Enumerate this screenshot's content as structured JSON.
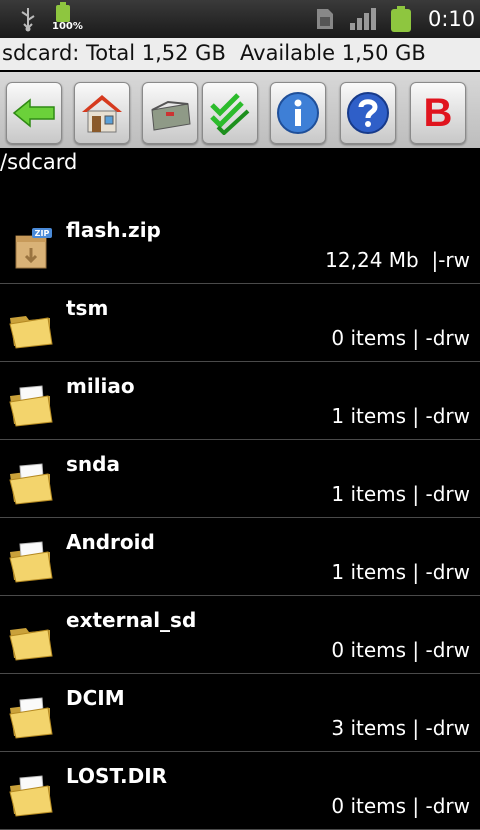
{
  "statusbar": {
    "battery_percent": "100%",
    "time": "0:10"
  },
  "storage": {
    "total": "sdcard: Total 1,52 GB",
    "available": "Available 1,50 GB"
  },
  "toolbar": [
    {
      "name": "back-button",
      "icon": "green-left-arrow-icon"
    },
    {
      "name": "home-button",
      "icon": "home-icon"
    },
    {
      "name": "multi-select-button",
      "icon": "toolbox-icon"
    },
    {
      "name": "check-all-button",
      "icon": "green-checks-icon"
    },
    {
      "name": "info-button",
      "icon": "info-icon"
    },
    {
      "name": "help-button",
      "icon": "help-icon"
    },
    {
      "name": "bookmark-button",
      "icon": "red-b-icon",
      "letter": "B"
    }
  ],
  "path": "/sdcard",
  "files": [
    {
      "name": "flash.zip",
      "meta": "12,24 Mb  |-rw",
      "type": "zip"
    },
    {
      "name": "tsm",
      "meta": "0 items | -drw",
      "type": "folder"
    },
    {
      "name": "miliao",
      "meta": "1 items | -drw",
      "type": "folder"
    },
    {
      "name": "snda",
      "meta": "1 items | -drw",
      "type": "folder"
    },
    {
      "name": "Android",
      "meta": "1 items | -drw",
      "type": "folder"
    },
    {
      "name": "external_sd",
      "meta": "0 items | -drw",
      "type": "folder"
    },
    {
      "name": "DCIM",
      "meta": "3 items | -drw",
      "type": "folder"
    },
    {
      "name": "LOST.DIR",
      "meta": "0 items | -drw",
      "type": "folder"
    }
  ],
  "zip_badge": "ZIP"
}
